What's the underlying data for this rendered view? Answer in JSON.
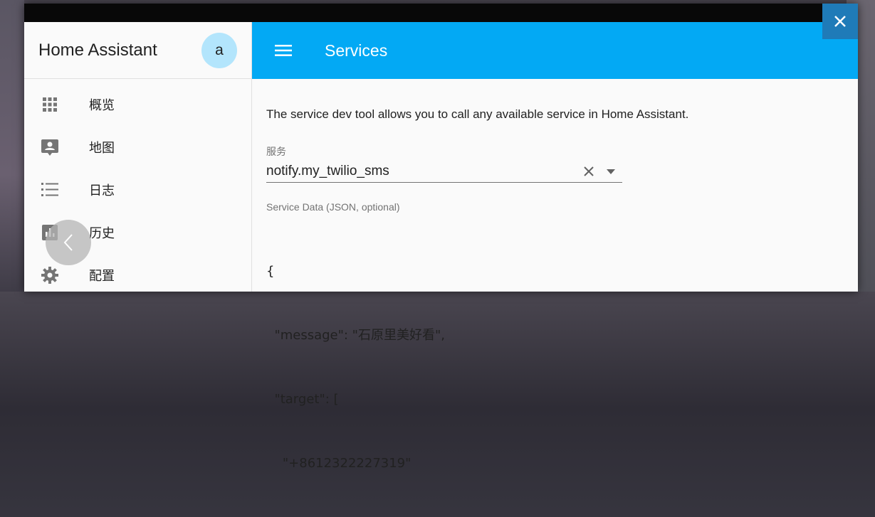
{
  "sidebar": {
    "app_title": "Home Assistant",
    "avatar_initial": "a",
    "items": [
      {
        "label": "概览",
        "icon": "apps-grid-icon"
      },
      {
        "label": "地图",
        "icon": "account-box-icon"
      },
      {
        "label": "日志",
        "icon": "list-icon"
      },
      {
        "label": "历史",
        "icon": "chart-bar-icon"
      },
      {
        "label": "配置",
        "icon": "gear-icon"
      }
    ]
  },
  "toolbar": {
    "title": "Services",
    "menu_icon": "menu-icon"
  },
  "content": {
    "description": "The service dev tool allows you to call any available service in Home Assistant.",
    "service_label": "服务",
    "service_value": "notify.my_twilio_sms",
    "service_data_label": "Service Data (JSON, optional)",
    "json_lines": [
      "{",
      "  \"message\": \"石原里美好看\",",
      "  \"target\": [",
      "    \"+8612322227319\""
    ]
  },
  "window": {
    "close_icon": "close-icon"
  },
  "colors": {
    "accent": "#03a9f4",
    "avatar_bg": "#b3e5fc",
    "close_bg": "#1f7bb8"
  }
}
